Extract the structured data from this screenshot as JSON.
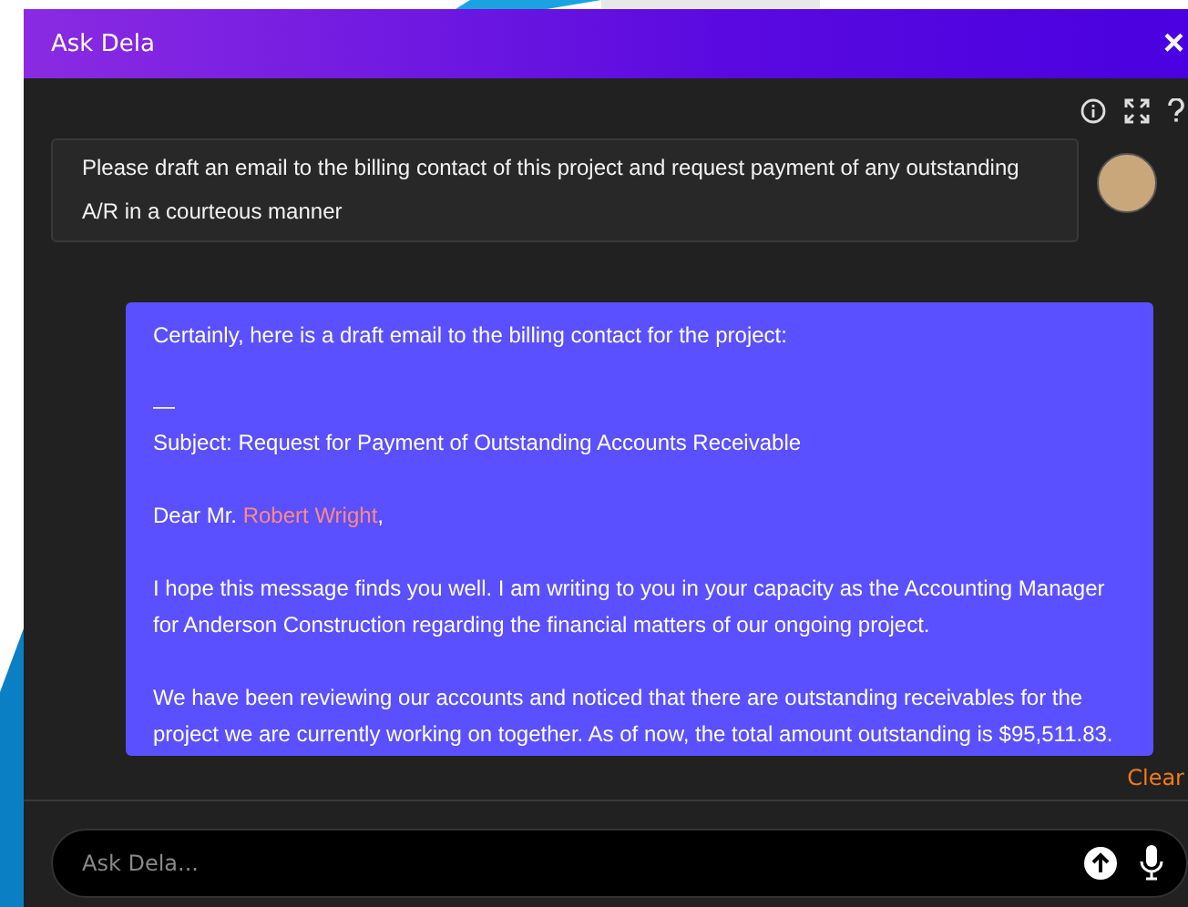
{
  "window": {
    "title": "Ask Dela",
    "close": "×"
  },
  "user_message": {
    "text": "Please draft an email to the billing contact of this project and request payment of any outstanding A/R in a courteous manner"
  },
  "reply": {
    "items": [
      {
        "kind": "text",
        "text": "Certainly, here is a draft email to the billing contact for the project:"
      },
      {
        "kind": "separator",
        "text": "—"
      },
      {
        "kind": "text",
        "text": "Subject: Request for Payment of Outstanding Accounts Receivable"
      },
      {
        "kind": "greeting",
        "prefix": "Dear Mr. ",
        "name": "Robert Wright",
        "suffix": ","
      },
      {
        "kind": "text",
        "text": "I hope this message finds you well. I am writing to you in your capacity as the Accounting Manager for Anderson Construction regarding the financial matters of our ongoing project."
      },
      {
        "kind": "text",
        "text": "We have been reviewing our accounts and noticed that there are outstanding receivables for the project we are currently working on together. As of now, the total amount outstanding is $95,511.83."
      }
    ]
  },
  "clear_button": "Clear",
  "input": {
    "placeholder": "Ask Dela..."
  }
}
